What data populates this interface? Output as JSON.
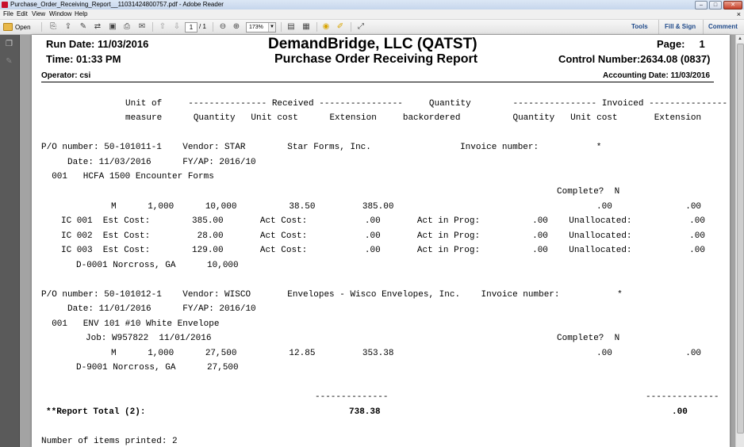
{
  "window": {
    "title": "Purchase_Order_Receiving_Report__11031424800757.pdf - Adobe Reader",
    "controls": [
      "–",
      "□",
      "✕"
    ]
  },
  "menu": {
    "items": [
      "File",
      "Edit",
      "View",
      "Window",
      "Help"
    ],
    "close_glyph": "×"
  },
  "toolbar": {
    "open_label": "Open",
    "page_current": "1",
    "page_total": "/ 1",
    "zoom": "173%",
    "tools_label": "Tools",
    "fill_sign_label": "Fill & Sign",
    "comment_label": "Comment"
  },
  "report": {
    "company": "DemandBridge, LLC  (QATST)",
    "title": "Purchase Order Receiving Report",
    "run_date": "Run Date: 11/03/2016",
    "time": "Time: 01:33 PM",
    "page": "Page:     1",
    "control_number": "Control Number:2634.08 (0837)",
    "operator": "Operator: csi",
    "accounting_date": "Accounting Date: 11/03/2016",
    "col_hdr_1": "Unit of     --------------- Received ----------------     Quantity        ---------------- Invoiced ---------------",
    "col_hdr_2": "measure      Quantity   Unit cost      Extension     backordered          Quantity   Unit cost       Extension",
    "po1": {
      "line1": "P/O number: 50-101011-1    Vendor: STAR        Star Forms, Inc.                 Invoice number:           *",
      "line2": "     Date: 11/03/2016      FY/AP: 2016/10",
      "line3": "  001   HCFA 1500 Encounter Forms",
      "complete": "Complete?  N",
      "qty_line": "M      1,000      10,000          38.50         385.00",
      "inv_line": ".00              .00",
      "ic1": "IC 001  Est Cost:        385.00       Act Cost:           .00       Act in Prog:          .00    Unallocated:           .00",
      "ic2": "IC 002  Est Cost:         28.00       Act Cost:           .00       Act in Prog:          .00    Unallocated:           .00",
      "ic3": "IC 003  Est Cost:        129.00       Act Cost:           .00       Act in Prog:          .00    Unallocated:           .00",
      "dist": "D-0001 Norcross, GA      10,000"
    },
    "po2": {
      "line1": "P/O number: 50-101012-1    Vendor: WISCO       Envelopes - Wisco Envelopes, Inc.    Invoice number:           *",
      "line2": "     Date: 11/01/2016      FY/AP: 2016/10",
      "line3": "  001   ENV 101 #10 White Envelope",
      "job": "Job: W957822  11/01/2016",
      "complete": "Complete?  N",
      "qty_line": "M      1,000      27,500          12.85         353.38",
      "inv_line": ".00              .00",
      "dist": "D-9001 Norcross, GA      27,500"
    },
    "dashes": "--------------",
    "total_label": "**Report Total (2):",
    "total_received": "738.38",
    "total_invoiced": ".00",
    "items_printed": "Number of items printed: 2"
  }
}
